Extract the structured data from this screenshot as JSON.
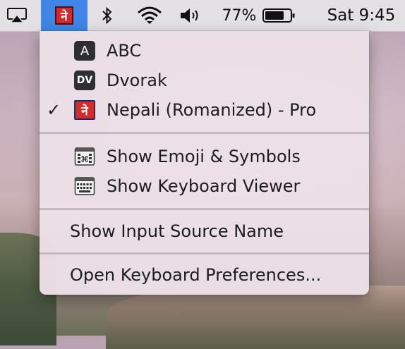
{
  "menubar": {
    "input_source_glyph": "ने",
    "battery_percent": "77%",
    "clock": "Sat 9:45",
    "icons": [
      "airplay-icon",
      "bluetooth-icon",
      "wifi-icon",
      "volume-icon",
      "battery-icon"
    ],
    "active_color": "#3f86e6"
  },
  "menu": {
    "sources": [
      {
        "badge": "A",
        "label": "ABC",
        "checked": false
      },
      {
        "badge": "DV",
        "label": "Dvorak",
        "checked": false
      },
      {
        "badge": "ने",
        "label": "Nepali (Romanized) - Pro",
        "checked": true
      }
    ],
    "check_mark": "✓",
    "actions": [
      {
        "label": "Show Emoji & Symbols",
        "icon": "emoji-symbols-icon"
      },
      {
        "label": "Show Keyboard Viewer",
        "icon": "keyboard-viewer-icon"
      }
    ],
    "show_input_source_name": "Show Input Source Name",
    "open_preferences": "Open Keyboard Preferences..."
  }
}
